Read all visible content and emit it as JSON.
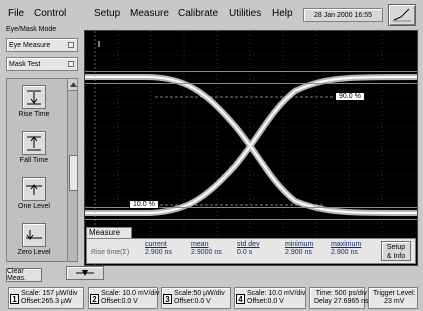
{
  "menu": {
    "file": "File",
    "control": "Control",
    "setup": "Setup",
    "measure": "Measure",
    "calibrate": "Calibrate",
    "utilities": "Utilities",
    "help": "Help"
  },
  "datetime": "28 Jan 2000  16:55",
  "sidebar": {
    "mode_label": "Eye/Mask Mode",
    "mode_select": "Eye Measure",
    "test_select": "Mask Test",
    "tools": [
      {
        "label": "Rise Time",
        "icon": "rise-time-icon"
      },
      {
        "label": "Fall Time",
        "icon": "fall-time-icon"
      },
      {
        "label": "One Level",
        "icon": "one-level-icon"
      },
      {
        "label": "Zero Level",
        "icon": "zero-level-icon"
      }
    ]
  },
  "screen": {
    "marker_high": "90.0 %",
    "marker_low": "10.0 %",
    "trace_color": "#ffffff",
    "grid_color": "#606060"
  },
  "measure": {
    "tab": "Measure",
    "name": "Rise time(Σ)",
    "headers": [
      "current",
      "mean",
      "std dev",
      "minimum",
      "maximum"
    ],
    "values": [
      "2.900 ns",
      "2.9000 ns",
      "0.0 s",
      "2.900 ns",
      "2.900 ns"
    ],
    "setup_line1": "Setup",
    "setup_line2": "& Info"
  },
  "buttons": {
    "clear": "Clear Meas."
  },
  "status": {
    "ch1": {
      "num": "1",
      "scale": "Scale: 157 µW/div",
      "offset": "Offset:265.3 µW"
    },
    "ch2": {
      "num": "2",
      "scale": "Scale: 10.0 mV/div",
      "offset": "Offset:0.0 V"
    },
    "ch3": {
      "num": "3",
      "scale": "Scale:50 µW/div",
      "offset": "Offset:0.0 V"
    },
    "ch4": {
      "num": "4",
      "scale": "Scale: 10.0 mV/div",
      "offset": "Offset:0.0 V"
    },
    "time": {
      "line1": "Time: 500 ps/div",
      "line2": "Delay 27.6965 ns"
    },
    "trigger": {
      "line1": "Trigger Level:",
      "line2": "23 mV"
    }
  }
}
